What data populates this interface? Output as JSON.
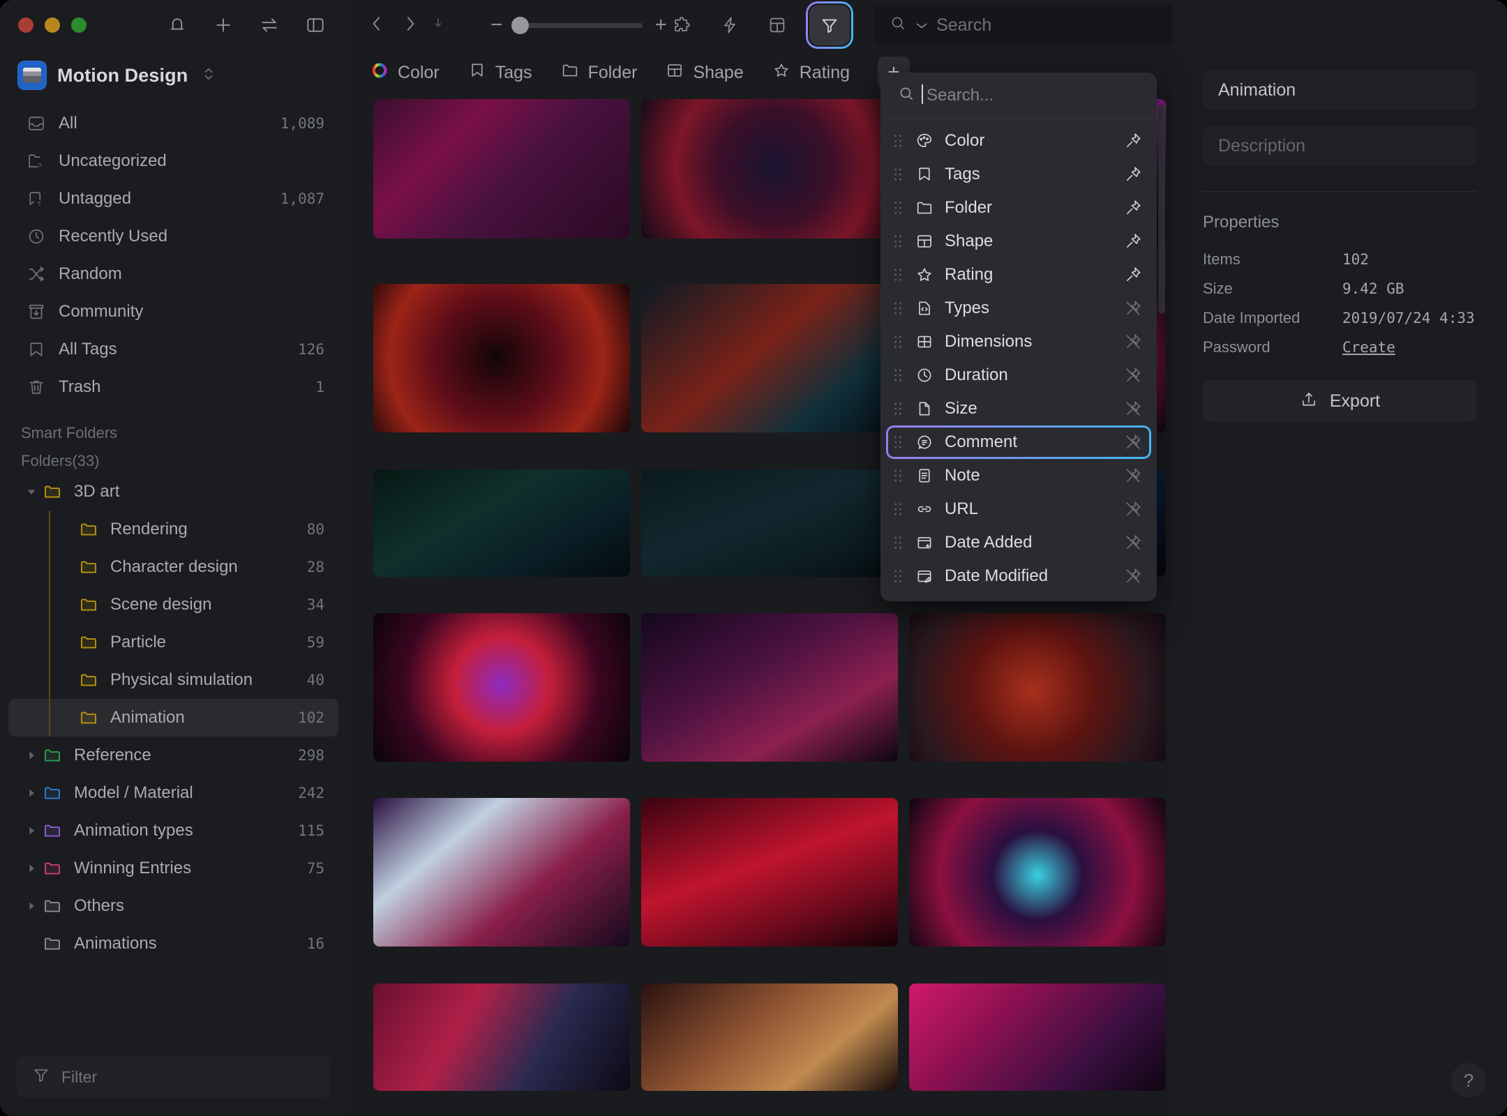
{
  "window": {
    "traffic_lights": [
      "close",
      "minimize",
      "zoom"
    ],
    "header_icons": [
      "bell-icon",
      "plus-icon",
      "sync-icon",
      "sidebar-toggle-icon"
    ]
  },
  "sidebar": {
    "library_name": "Motion Design",
    "nav_items": [
      {
        "label": "All",
        "count": "1,089",
        "icon": "inbox-icon"
      },
      {
        "label": "Uncategorized",
        "count": "",
        "icon": "folder-question-icon"
      },
      {
        "label": "Untagged",
        "count": "1,087",
        "icon": "tag-question-icon"
      },
      {
        "label": "Recently Used",
        "count": "",
        "icon": "clock-icon"
      },
      {
        "label": "Random",
        "count": "",
        "icon": "shuffle-icon"
      },
      {
        "label": "Community",
        "count": "",
        "icon": "community-icon"
      },
      {
        "label": "All Tags",
        "count": "126",
        "icon": "bookmark-icon"
      },
      {
        "label": "Trash",
        "count": "1",
        "icon": "trash-icon"
      }
    ],
    "smart_folders_label": "Smart Folders",
    "folders_label": "Folders(33)",
    "tree": [
      {
        "label": "3D art",
        "count": "",
        "depth": 1,
        "expanded": true,
        "color": "#b8960f",
        "selected": false
      },
      {
        "label": "Rendering",
        "count": "80",
        "depth": 2,
        "expanded": null,
        "color": "#b8960f",
        "selected": false
      },
      {
        "label": "Character design",
        "count": "28",
        "depth": 2,
        "expanded": null,
        "color": "#b8960f",
        "selected": false
      },
      {
        "label": "Scene design",
        "count": "34",
        "depth": 2,
        "expanded": null,
        "color": "#b8960f",
        "selected": false
      },
      {
        "label": "Particle",
        "count": "59",
        "depth": 2,
        "expanded": null,
        "color": "#b8960f",
        "selected": false
      },
      {
        "label": "Physical simulation",
        "count": "40",
        "depth": 2,
        "expanded": null,
        "color": "#b8960f",
        "selected": false
      },
      {
        "label": "Animation",
        "count": "102",
        "depth": 2,
        "expanded": null,
        "color": "#b8960f",
        "selected": true
      },
      {
        "label": "Reference",
        "count": "298",
        "depth": 1,
        "expanded": false,
        "color": "#2f9e4f",
        "selected": false
      },
      {
        "label": "Model / Material",
        "count": "242",
        "depth": 1,
        "expanded": false,
        "color": "#2f7fd4",
        "selected": false
      },
      {
        "label": "Animation types",
        "count": "115",
        "depth": 1,
        "expanded": false,
        "color": "#8a5ed6",
        "selected": false
      },
      {
        "label": "Winning Entries",
        "count": "75",
        "depth": 1,
        "expanded": false,
        "color": "#cc3b7e",
        "selected": false
      },
      {
        "label": "Others",
        "count": "",
        "depth": 1,
        "expanded": false,
        "color": "#8b8e93",
        "selected": false
      },
      {
        "label": "Animations",
        "count": "16",
        "depth": 1,
        "expanded": null,
        "color": "#8b8e93",
        "selected": false
      }
    ],
    "filter_placeholder": "Filter"
  },
  "toolbar": {
    "back_icon": "chevron-left-icon",
    "forward_icon": "chevron-right-icon",
    "download_icon": "download-icon",
    "zoom_out_label": "−",
    "zoom_in_label": "+",
    "zoom_value": 12,
    "right_icons": [
      "extension-icon",
      "lightning-icon",
      "layout-icon"
    ],
    "filter_icon": "filter-icon",
    "filter_active": true,
    "search_placeholder": "Search",
    "pin_icon": "pin-icon"
  },
  "filter_bar": {
    "items": [
      {
        "label": "Color",
        "icon": "color-wheel-icon"
      },
      {
        "label": "Tags",
        "icon": "bookmark-icon"
      },
      {
        "label": "Folder",
        "icon": "folder-icon"
      },
      {
        "label": "Shape",
        "icon": "shape-icon"
      },
      {
        "label": "Rating",
        "icon": "star-icon"
      }
    ],
    "add_label": "+"
  },
  "dropdown": {
    "search_placeholder": "Search...",
    "items": [
      {
        "label": "Color",
        "icon": "palette-icon",
        "pinned": true
      },
      {
        "label": "Tags",
        "icon": "bookmark-icon",
        "pinned": true
      },
      {
        "label": "Folder",
        "icon": "folder-icon",
        "pinned": true
      },
      {
        "label": "Shape",
        "icon": "shape-icon",
        "pinned": true
      },
      {
        "label": "Rating",
        "icon": "star-icon",
        "pinned": true
      },
      {
        "label": "Types",
        "icon": "code-file-icon",
        "pinned": false
      },
      {
        "label": "Dimensions",
        "icon": "dimensions-icon",
        "pinned": false
      },
      {
        "label": "Duration",
        "icon": "clock-icon",
        "pinned": false
      },
      {
        "label": "Size",
        "icon": "file-icon",
        "pinned": false
      },
      {
        "label": "Comment",
        "icon": "comment-icon",
        "pinned": false,
        "selected": true
      },
      {
        "label": "Note",
        "icon": "note-icon",
        "pinned": false
      },
      {
        "label": "URL",
        "icon": "link-icon",
        "pinned": false
      },
      {
        "label": "Date Added",
        "icon": "calendar-plus-icon",
        "pinned": false
      },
      {
        "label": "Date Modified",
        "icon": "calendar-edit-icon",
        "pinned": false
      }
    ],
    "highlight_color_start": "#9b7cf0",
    "highlight_color_end": "#3fb8f5"
  },
  "inspector": {
    "title_value": "Animation",
    "description_placeholder": "Description",
    "properties_label": "Properties",
    "properties": [
      {
        "key": "Items",
        "value": "102",
        "link": false
      },
      {
        "key": "Size",
        "value": "9.42 GB",
        "link": false
      },
      {
        "key": "Date Imported",
        "value": "2019/07/24 4:33",
        "link": false
      },
      {
        "key": "Password",
        "value": "Create",
        "link": true
      }
    ],
    "export_label": "Export",
    "help_label": "?"
  },
  "grid": {
    "cells": [
      {
        "g": "linear-gradient(135deg,#3a0f2e 0%,#7a1048 30%,#48123f 55%,#2a0a22 100%)"
      },
      {
        "g": "radial-gradient(circle at 52% 48%,#1a1430 0%,#3c0f28 38%,#7d1628 65%,#120a18 100%)"
      },
      {
        "g": "linear-gradient(160deg,#0c1a18 0%,#8a1d8e 42%,#2a0d3a 70%,#060d0c 100%)"
      },
      {
        "g": "radial-gradient(circle at 48% 50%,#120608 0%,#5e0d18 40%,#9c2418 70%,#1a0608 100%)"
      },
      {
        "g": "linear-gradient(140deg,#0e1b24 0%,#7a2218 45%,#10303a 75%,#081018 100%)"
      },
      {
        "g": "radial-gradient(circle at 50% 50%,#10082a 0%,#3a0d52 35%,#8e1648 70%,#0a0614 100%)"
      },
      {
        "g": "linear-gradient(150deg,#071814 0%,#10302c 40%,#0a1f26 70%,#040c10 100%)"
      },
      {
        "g": "linear-gradient(160deg,#0a1a1e 0%,#12282e 45%,#0b1a20 80%,#050c10 100%)"
      },
      {
        "g": "linear-gradient(120deg,#0a0610 0%,#5e0f2a 40%,#0d2a4e 70%,#07050c 100%)"
      },
      {
        "g": "radial-gradient(circle at 50% 48%,#8e2bc0 0%,#c41f3a 32%,#3a0620 65%,#0a0408 100%)"
      },
      {
        "g": "linear-gradient(150deg,#14081e 0%,#4a1240 40%,#8c2050 70%,#0c0612 100%)"
      },
      {
        "g": "radial-gradient(circle at 48% 52%,#a8301c 0%,#5e1410 40%,#2a1820 75%,#120a10 100%)"
      },
      {
        "g": "linear-gradient(140deg,#2a1040 0%,#c0d0e0 30%,#8a1f4a 62%,#140a1c 100%)"
      },
      {
        "g": "linear-gradient(160deg,#3a0410 0%,#c0142e 45%,#6a0a1c 75%,#120206 100%)"
      },
      {
        "g": "radial-gradient(circle at 50% 52%,#3ad0e0 0%,#2a1040 30%,#8c1040 65%,#0c0610 100%)"
      },
      {
        "g": "linear-gradient(120deg,#6a1030 0%,#b02048 35%,#2a2a50 65%,#0c0a14 100%)"
      },
      {
        "g": "linear-gradient(140deg,#2a1210 0%,#8a5030 40%,#c08a50 70%,#140a08 100%)"
      },
      {
        "g": "linear-gradient(135deg,#d01a6a 0%,#8a1050 35%,#3a1040 70%,#0e0612 100%)"
      }
    ]
  }
}
